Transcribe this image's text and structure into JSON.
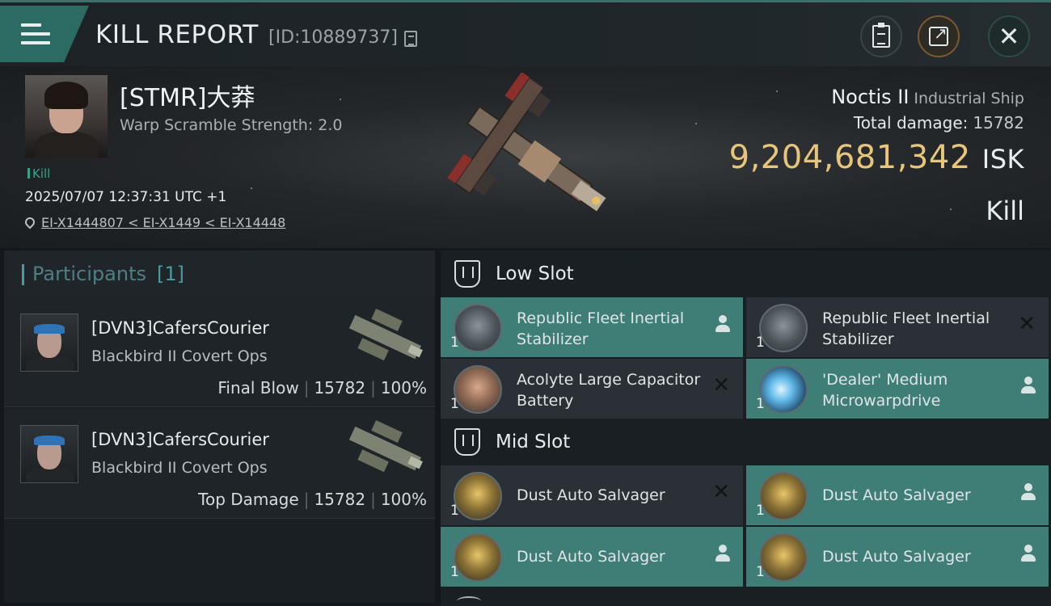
{
  "header": {
    "title": "KILL REPORT",
    "kill_id": "[ID:10889737]",
    "icons": [
      "menu-icon",
      "copy-icon",
      "clipboard-icon",
      "share-icon",
      "close-icon"
    ]
  },
  "victim": {
    "name": "[STMR]大莽",
    "warp_scramble": "Warp Scramble Strength: 2.0",
    "tag": "Kill",
    "time": "2025/07/07 12:37:31 UTC +1",
    "location": "EI-X1444807 < EI-X1449 < EI-X14448",
    "ship_name": "Noctis II",
    "ship_class": "Industrial Ship",
    "total_damage_label": "Total damage:",
    "total_damage": "15782",
    "isk_value": "9,204,681,342",
    "isk_unit": "ISK",
    "result": "Kill"
  },
  "participants": {
    "title": "Participants",
    "count": "[1]",
    "rows": [
      {
        "name": "[DVN3]CafersCourier",
        "ship": "Blackbird II Covert Ops",
        "role": "Final Blow",
        "damage": "15782",
        "percent": "100%"
      },
      {
        "name": "[DVN3]CafersCourier",
        "ship": "Blackbird II Covert Ops",
        "role": "Top Damage",
        "damage": "15782",
        "percent": "100%"
      }
    ]
  },
  "low_slot": {
    "title": "Low Slot",
    "modules": [
      {
        "name": "Republic Fleet Inertial Stabilizer",
        "qty": "1",
        "state": "dropped"
      },
      {
        "name": "Republic Fleet Inertial Stabilizer",
        "qty": "1",
        "state": "destroyed"
      },
      {
        "name": "Acolyte Large Capacitor Battery",
        "qty": "1",
        "state": "destroyed"
      },
      {
        "name": "'Dealer' Medium Microwarpdrive",
        "qty": "1",
        "state": "dropped"
      }
    ]
  },
  "mid_slot": {
    "title": "Mid Slot",
    "modules": [
      {
        "name": "Dust Auto Salvager",
        "qty": "1",
        "state": "destroyed"
      },
      {
        "name": "Dust Auto Salvager",
        "qty": "1",
        "state": "dropped"
      },
      {
        "name": "Dust Auto Salvager",
        "qty": "1",
        "state": "dropped"
      },
      {
        "name": "Dust Auto Salvager",
        "qty": "1",
        "state": "dropped"
      }
    ]
  },
  "colors": {
    "accent": "#3f7e76",
    "isk_gold": "#e7c67c",
    "participants_title": "#4e7f85"
  },
  "status_glyphs": {
    "dropped": "person-icon",
    "destroyed": "x-icon"
  }
}
